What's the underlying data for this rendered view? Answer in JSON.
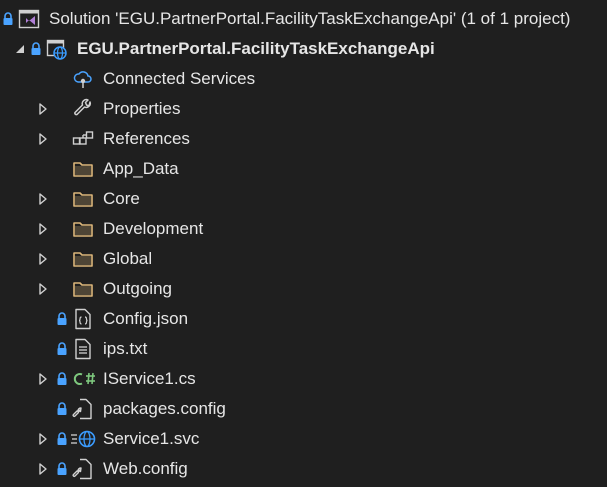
{
  "solution": {
    "label": "Solution 'EGU.PartnerPortal.FacilityTaskExchangeApi' (1 of 1 project)"
  },
  "project": {
    "label": "EGU.PartnerPortal.FacilityTaskExchangeApi"
  },
  "items": [
    {
      "label": "Connected Services"
    },
    {
      "label": "Properties"
    },
    {
      "label": "References"
    },
    {
      "label": "App_Data"
    },
    {
      "label": "Core"
    },
    {
      "label": "Development"
    },
    {
      "label": "Global"
    },
    {
      "label": "Outgoing"
    },
    {
      "label": "Config.json"
    },
    {
      "label": "ips.txt"
    },
    {
      "label": "IService1.cs"
    },
    {
      "label": "packages.config"
    },
    {
      "label": "Service1.svc"
    },
    {
      "label": "Web.config"
    }
  ],
  "colors": {
    "background": "#1f1f1f",
    "text": "#e6e6e6",
    "lock": "#4aa3ff",
    "folder": "#dcb67a",
    "csharp": "#7ec87e",
    "globe": "#3b9cff"
  }
}
